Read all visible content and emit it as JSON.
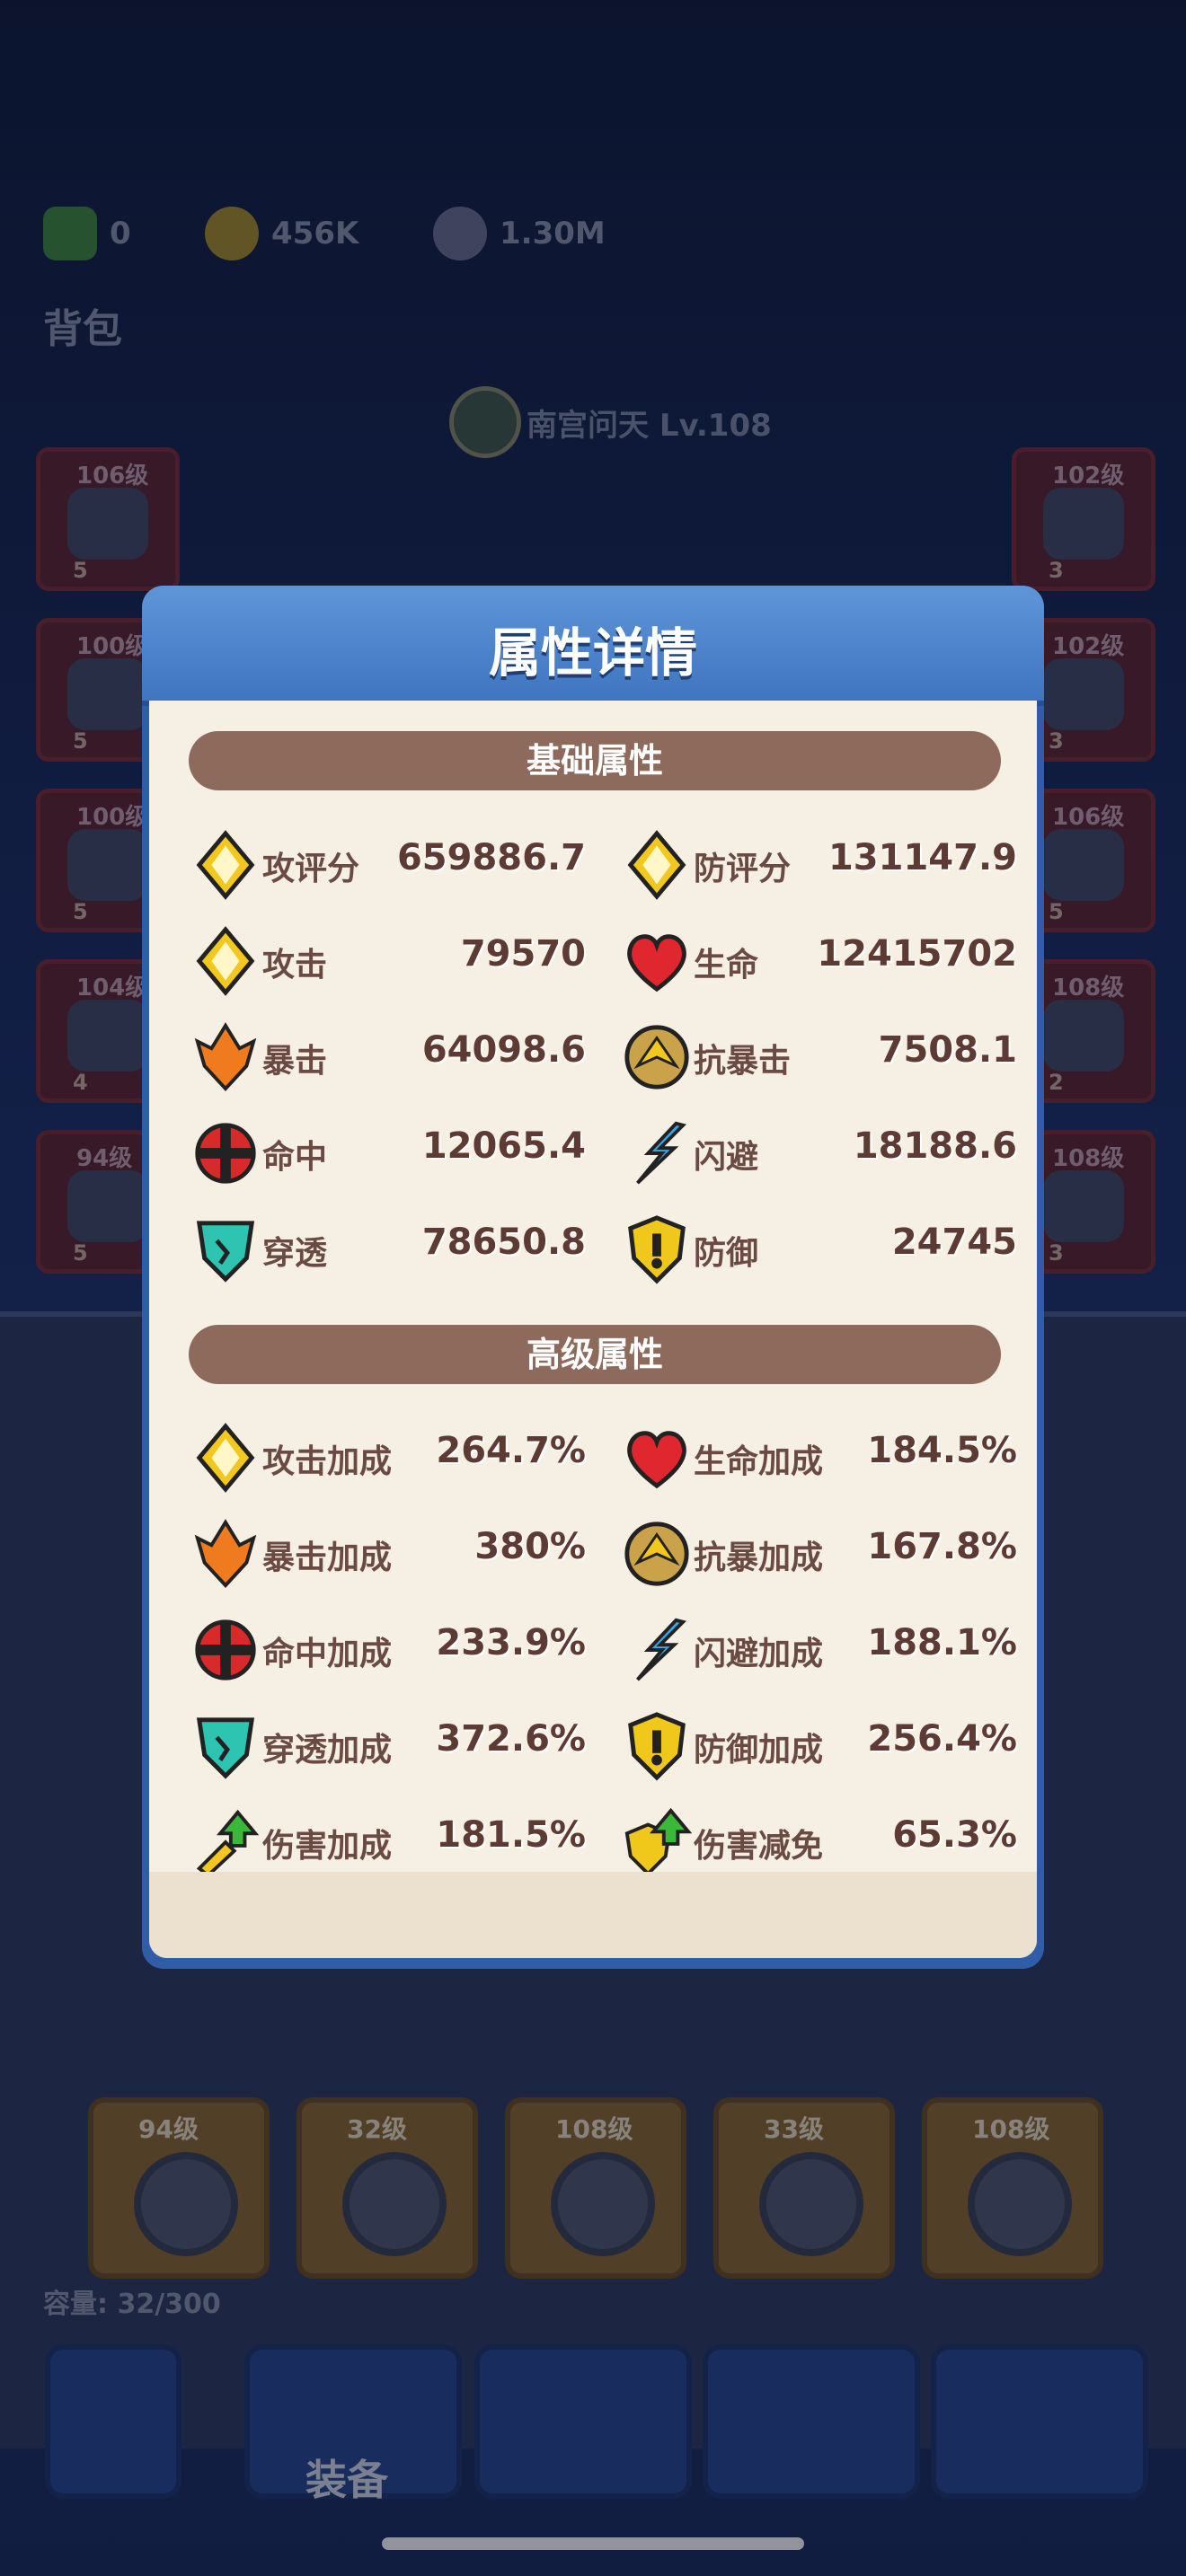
{
  "currency": {
    "gem": "0",
    "gold": "456K",
    "silver": "1.30M"
  },
  "bag": {
    "title": "背包",
    "capacity": "容量: 32/300"
  },
  "hero": {
    "name": "南宫问天 Lv.108"
  },
  "left_slots": [
    {
      "level": "106级",
      "count": "5"
    },
    {
      "level": "100级",
      "count": "5"
    },
    {
      "level": "100级",
      "count": "5"
    },
    {
      "level": "104级",
      "count": "4"
    },
    {
      "level": "94级",
      "count": "5"
    }
  ],
  "right_slots": [
    {
      "level": "102级",
      "count": "3"
    },
    {
      "level": "102级",
      "count": "3"
    },
    {
      "level": "106级",
      "count": "5"
    },
    {
      "level": "108级",
      "count": "2"
    },
    {
      "level": "108级",
      "count": "3"
    }
  ],
  "inventory_bottom": [
    {
      "level": "94级"
    },
    {
      "level": "32级"
    },
    {
      "level": "108级"
    },
    {
      "level": "33级"
    },
    {
      "level": "108级"
    }
  ],
  "nav": {
    "active_label": "装备"
  },
  "modal": {
    "title": "属性详情",
    "basic": {
      "header": "基础属性",
      "rows": [
        {
          "left": {
            "name": "攻评分",
            "value": "659886.7",
            "icon": "attack-score-icon"
          },
          "right": {
            "name": "防评分",
            "value": "131147.9",
            "icon": "defense-score-icon"
          }
        },
        {
          "left": {
            "name": "攻击",
            "value": "79570",
            "icon": "attack-icon"
          },
          "right": {
            "name": "生命",
            "value": "12415702",
            "icon": "heart-icon"
          }
        },
        {
          "left": {
            "name": "暴击",
            "value": "64098.6",
            "icon": "crit-icon"
          },
          "right": {
            "name": "抗暴击",
            "value": "7508.1",
            "icon": "crit-resist-icon"
          }
        },
        {
          "left": {
            "name": "命中",
            "value": "12065.4",
            "icon": "hit-icon"
          },
          "right": {
            "name": "闪避",
            "value": "18188.6",
            "icon": "dodge-icon"
          }
        },
        {
          "left": {
            "name": "穿透",
            "value": "78650.8",
            "icon": "pierce-icon"
          },
          "right": {
            "name": "防御",
            "value": "24745",
            "icon": "shield-icon"
          }
        }
      ]
    },
    "advanced": {
      "header": "高级属性",
      "rows": [
        {
          "left": {
            "name": "攻击加成",
            "value": "264.7%",
            "icon": "attack-icon"
          },
          "right": {
            "name": "生命加成",
            "value": "184.5%",
            "icon": "heart-icon"
          }
        },
        {
          "left": {
            "name": "暴击加成",
            "value": "380%",
            "icon": "crit-icon"
          },
          "right": {
            "name": "抗暴加成",
            "value": "167.8%",
            "icon": "crit-resist-icon"
          }
        },
        {
          "left": {
            "name": "命中加成",
            "value": "233.9%",
            "icon": "hit-icon"
          },
          "right": {
            "name": "闪避加成",
            "value": "188.1%",
            "icon": "dodge-icon"
          }
        },
        {
          "left": {
            "name": "穿透加成",
            "value": "372.6%",
            "icon": "pierce-icon"
          },
          "right": {
            "name": "防御加成",
            "value": "256.4%",
            "icon": "shield-icon"
          }
        },
        {
          "left": {
            "name": "伤害加成",
            "value": "181.5%",
            "icon": "damage-up-icon"
          },
          "right": {
            "name": "伤害减免",
            "value": "65.3%",
            "icon": "damage-reduce-icon"
          }
        }
      ]
    }
  },
  "colors": {
    "attack": "#f2c81e",
    "heart": "#e0262e",
    "crit": "#f07a1e",
    "hit": "#d82a2a",
    "dodge": "#36a8e8",
    "pierce": "#2ec4b2",
    "shield": "#f0c81c",
    "section": "#8d6a5c"
  }
}
